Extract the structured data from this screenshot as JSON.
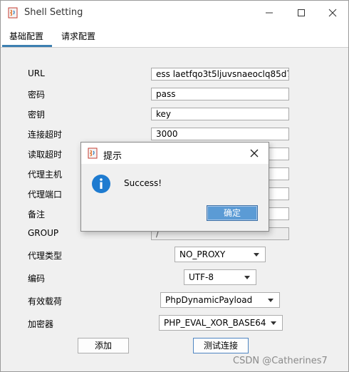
{
  "window": {
    "title": "Shell Setting"
  },
  "tabs": [
    {
      "label": "基础配置"
    },
    {
      "label": "请求配置"
    }
  ],
  "fields": {
    "url": {
      "label": "URL",
      "value": "ess laetfqo3t5ljuvsnaeoclq85d7"
    },
    "password": {
      "label": "密码",
      "value": "pass"
    },
    "key": {
      "label": "密钥",
      "value": "key"
    },
    "conn_timeout": {
      "label": "连接超时",
      "value": "3000"
    },
    "read_timeout": {
      "label": "读取超时",
      "value": ""
    },
    "proxy_host": {
      "label": "代理主机",
      "value": ""
    },
    "proxy_port": {
      "label": "代理端口",
      "value": ""
    },
    "remark": {
      "label": "备注",
      "value": ""
    },
    "group": {
      "label": "GROUP",
      "value": "/"
    }
  },
  "selects": {
    "proxy_type": {
      "label": "代理类型",
      "value": "NO_PROXY"
    },
    "encoding": {
      "label": "编码",
      "value": "UTF-8"
    },
    "payload": {
      "label": "有效载荷",
      "value": "PhpDynamicPayload"
    },
    "cryption": {
      "label": "加密器",
      "value": "PHP_EVAL_XOR_BASE64"
    }
  },
  "buttons": {
    "add": "添加",
    "test": "测试连接"
  },
  "dialog": {
    "title": "提示",
    "message": "Success!",
    "ok": "确定"
  },
  "watermark": "CSDN @Catherines7",
  "colors": {
    "accent": "#3c7fb1",
    "ok_button": "#5b9bd5",
    "info_icon": "#1e7bd0"
  }
}
